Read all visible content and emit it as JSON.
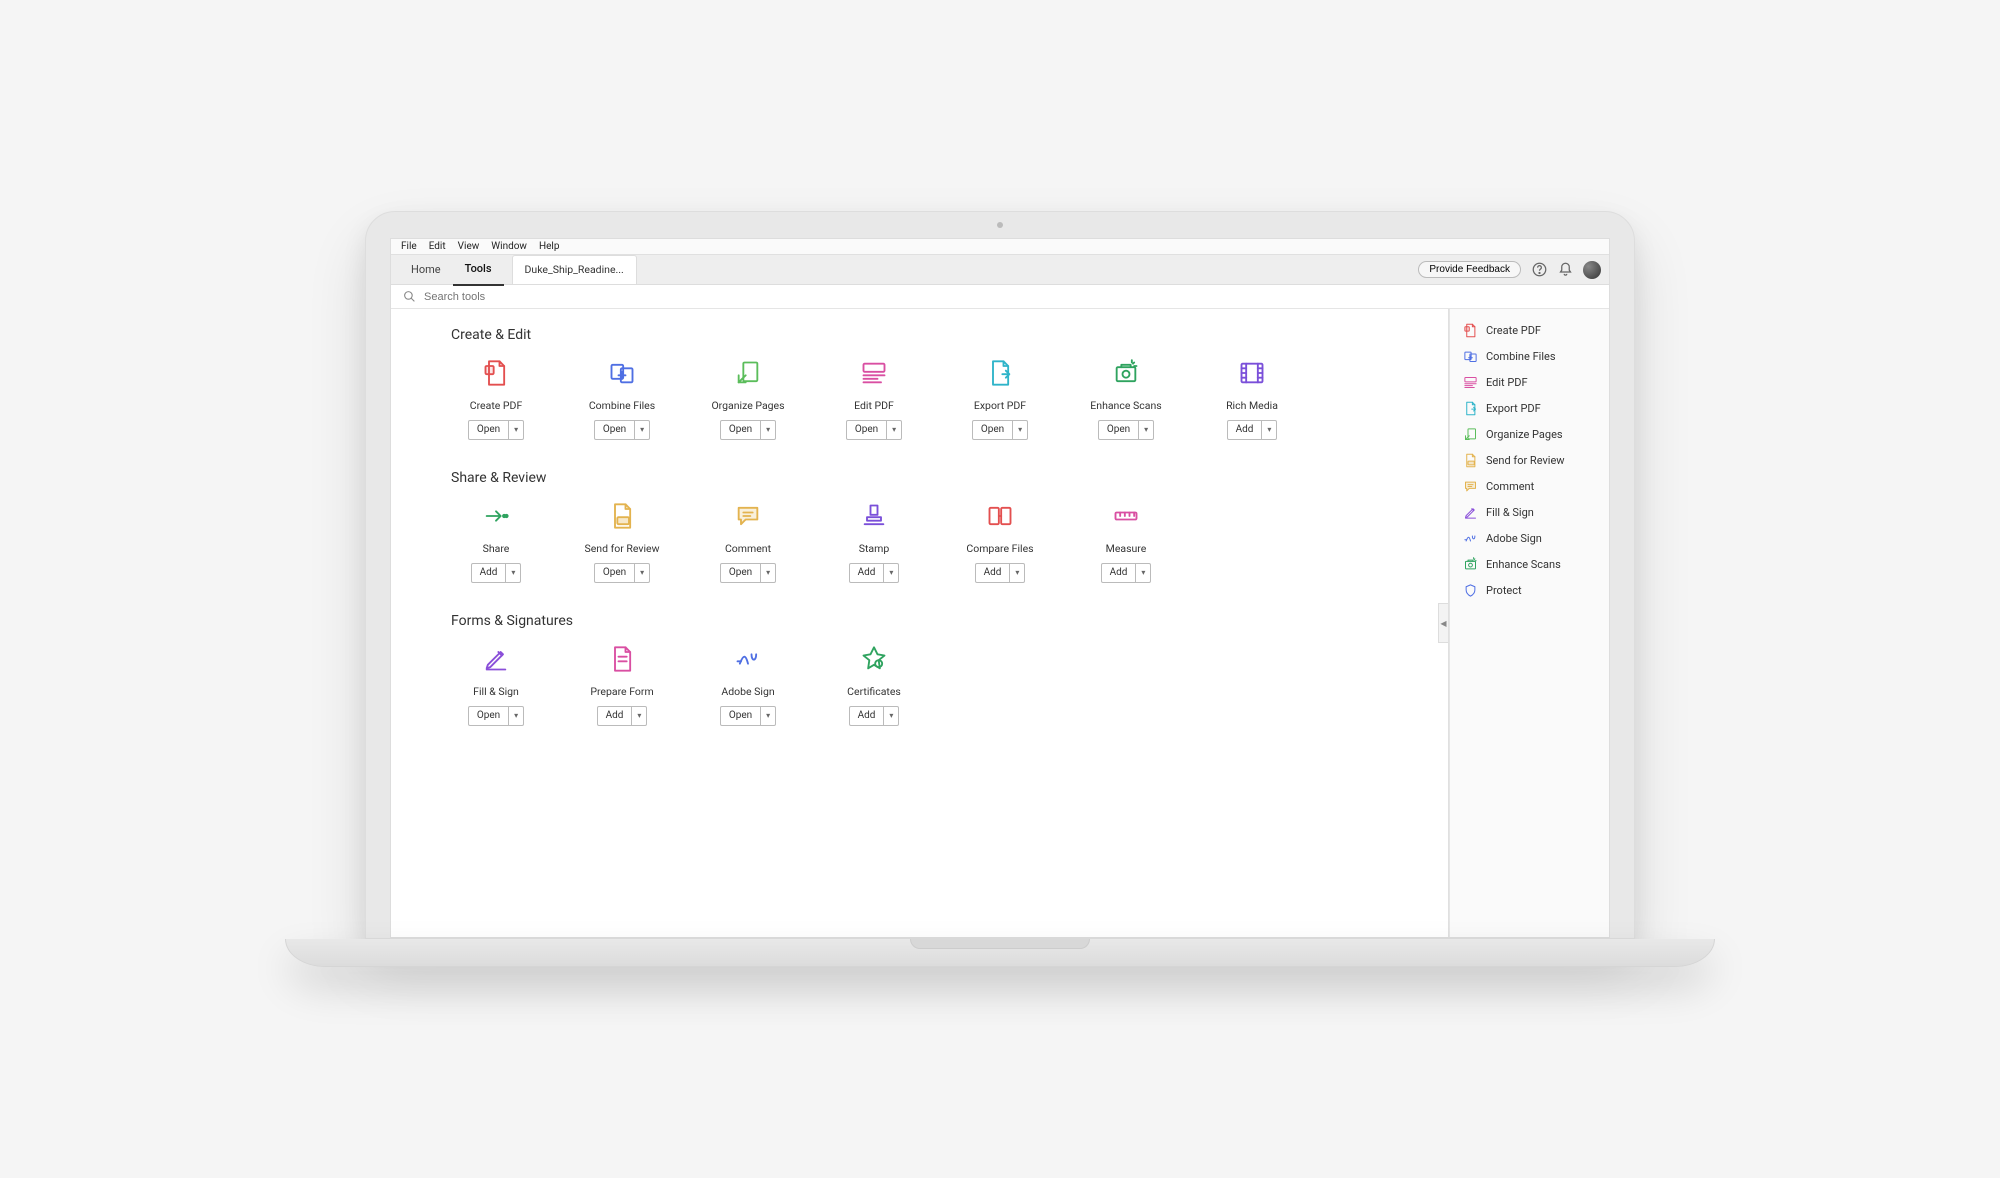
{
  "menu": {
    "items": [
      "File",
      "Edit",
      "View",
      "Window",
      "Help"
    ]
  },
  "tabs": {
    "home": "Home",
    "tools": "Tools",
    "doc": "Duke_Ship_Readine..."
  },
  "topbar": {
    "feedback": "Provide Feedback"
  },
  "search": {
    "placeholder": "Search tools"
  },
  "sections": {
    "create_edit": {
      "title": "Create & Edit",
      "tools": [
        {
          "id": "create-pdf",
          "label": "Create PDF",
          "action": "Open",
          "color": "#e34f4f"
        },
        {
          "id": "combine-files",
          "label": "Combine Files",
          "action": "Open",
          "color": "#4f6fe3"
        },
        {
          "id": "organize-pages",
          "label": "Organize Pages",
          "action": "Open",
          "color": "#5bbd5b"
        },
        {
          "id": "edit-pdf",
          "label": "Edit PDF",
          "action": "Open",
          "color": "#d94fa2"
        },
        {
          "id": "export-pdf",
          "label": "Export PDF",
          "action": "Open",
          "color": "#2fb4c9"
        },
        {
          "id": "enhance-scans",
          "label": "Enhance Scans",
          "action": "Open",
          "color": "#2fa35f"
        },
        {
          "id": "rich-media",
          "label": "Rich Media",
          "action": "Add",
          "color": "#7a4fd9"
        }
      ]
    },
    "share_review": {
      "title": "Share & Review",
      "tools": [
        {
          "id": "share",
          "label": "Share",
          "action": "Add",
          "color": "#2fa35f"
        },
        {
          "id": "send-review",
          "label": "Send for Review",
          "action": "Open",
          "color": "#e3b34f"
        },
        {
          "id": "comment",
          "label": "Comment",
          "action": "Open",
          "color": "#e3b34f"
        },
        {
          "id": "stamp",
          "label": "Stamp",
          "action": "Add",
          "color": "#7a4fd9"
        },
        {
          "id": "compare-files",
          "label": "Compare Files",
          "action": "Add",
          "color": "#e34f4f"
        },
        {
          "id": "measure",
          "label": "Measure",
          "action": "Add",
          "color": "#d94fa2"
        }
      ]
    },
    "forms_sig": {
      "title": "Forms & Signatures",
      "tools": [
        {
          "id": "fill-sign",
          "label": "Fill & Sign",
          "action": "Open",
          "color": "#8a4fd9"
        },
        {
          "id": "prepare-form",
          "label": "Prepare Form",
          "action": "Add",
          "color": "#d94fa2"
        },
        {
          "id": "adobe-sign",
          "label": "Adobe Sign",
          "action": "Open",
          "color": "#4f6fe3"
        },
        {
          "id": "certificates",
          "label": "Certificates",
          "action": "Add",
          "color": "#2fa35f"
        }
      ]
    }
  },
  "sidebar": {
    "items": [
      {
        "id": "create-pdf",
        "label": "Create PDF",
        "color": "#e34f4f"
      },
      {
        "id": "combine-files",
        "label": "Combine Files",
        "color": "#4f6fe3"
      },
      {
        "id": "edit-pdf",
        "label": "Edit PDF",
        "color": "#d94fa2"
      },
      {
        "id": "export-pdf",
        "label": "Export PDF",
        "color": "#2fb4c9"
      },
      {
        "id": "organize-pages",
        "label": "Organize Pages",
        "color": "#5bbd5b"
      },
      {
        "id": "send-review",
        "label": "Send for Review",
        "color": "#e3b34f"
      },
      {
        "id": "comment",
        "label": "Comment",
        "color": "#e3b34f"
      },
      {
        "id": "fill-sign",
        "label": "Fill & Sign",
        "color": "#8a4fd9"
      },
      {
        "id": "adobe-sign",
        "label": "Adobe Sign",
        "color": "#4f6fe3"
      },
      {
        "id": "enhance-scans",
        "label": "Enhance Scans",
        "color": "#2fa35f"
      },
      {
        "id": "protect",
        "label": "Protect",
        "color": "#4f6fe3"
      }
    ]
  }
}
